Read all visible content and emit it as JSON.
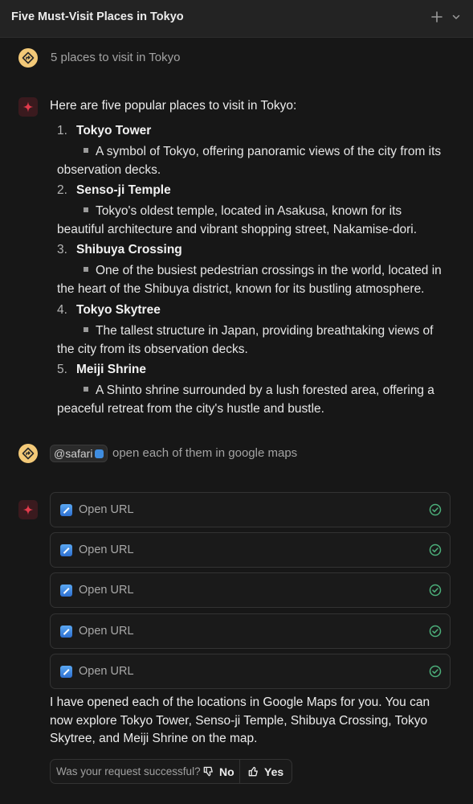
{
  "header": {
    "title": "Five Must-Visit Places in Tokyo",
    "add_icon": "plus-icon",
    "menu_icon": "chevron-down-icon"
  },
  "messages": {
    "first_user": "5 places to visit in Tokyo",
    "assistant_intro": "Here are five popular places to visit in Tokyo:",
    "places": [
      {
        "num": "1.",
        "title": "Tokyo Tower",
        "desc": "A symbol of Tokyo, offering panoramic views of the city from its observation decks."
      },
      {
        "num": "2.",
        "title": "Senso-ji Temple",
        "desc": "Tokyo's oldest temple, located in Asakusa, known for its beautiful architecture and vibrant shopping street, Nakamise-dori."
      },
      {
        "num": "3.",
        "title": "Shibuya Crossing",
        "desc": "One of the busiest pedestrian crossings in the world, located in the heart of the Shibuya district, known for its bustling atmosphere."
      },
      {
        "num": "4.",
        "title": "Tokyo Skytree",
        "desc": "The tallest structure in Japan, providing breathtaking views of the city from its observation decks."
      },
      {
        "num": "5.",
        "title": "Meiji Shrine",
        "desc": "A Shinto shrine surrounded by a lush forested area, offering a peaceful retreat from the city's hustle and bustle."
      }
    ],
    "second_user": {
      "mention": "@safari",
      "text": "open each of them in google maps"
    },
    "tool_calls": [
      {
        "label": "Open URL",
        "status": "done"
      },
      {
        "label": "Open URL",
        "status": "done"
      },
      {
        "label": "Open URL",
        "status": "done"
      },
      {
        "label": "Open URL",
        "status": "done"
      },
      {
        "label": "Open URL",
        "status": "done"
      }
    ],
    "final_reply": "I have opened each of the locations in Google Maps for you. You can now explore Tokyo Tower, Senso-ji Temple, Shibuya Crossing, Tokyo Skytree, and Meiji Shrine on the map."
  },
  "feedback": {
    "question": "Was your request successful?",
    "no_label": "No",
    "yes_label": "Yes"
  },
  "colors": {
    "background": "#171717",
    "user_avatar": "#f3c978",
    "success_check": "#4caf7a"
  }
}
